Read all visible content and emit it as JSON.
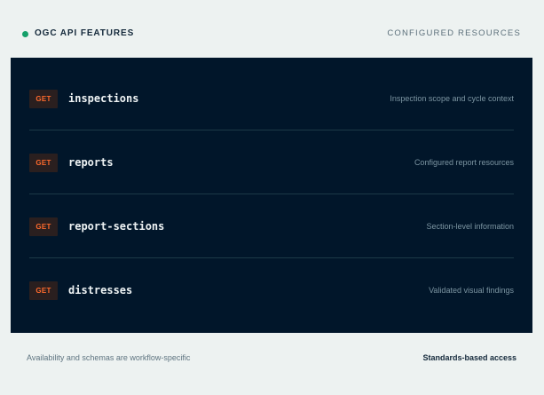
{
  "header": {
    "title": "OGC API FEATURES",
    "right_label": "CONFIGURED RESOURCES",
    "status_color": "#15a06a"
  },
  "resources": [
    {
      "method": "GET",
      "name": "inspections",
      "description": "Inspection scope and cycle context"
    },
    {
      "method": "GET",
      "name": "reports",
      "description": "Configured report resources"
    },
    {
      "method": "GET",
      "name": "report-sections",
      "description": "Section-level information"
    },
    {
      "method": "GET",
      "name": "distresses",
      "description": "Validated visual findings"
    }
  ],
  "footer": {
    "note": "Availability and schemas are workflow-specific",
    "right_label": "Standards-based access"
  },
  "colors": {
    "panel_background": "#01162a",
    "method_text": "#ff6a2d",
    "page_background": "#edf2f1"
  }
}
